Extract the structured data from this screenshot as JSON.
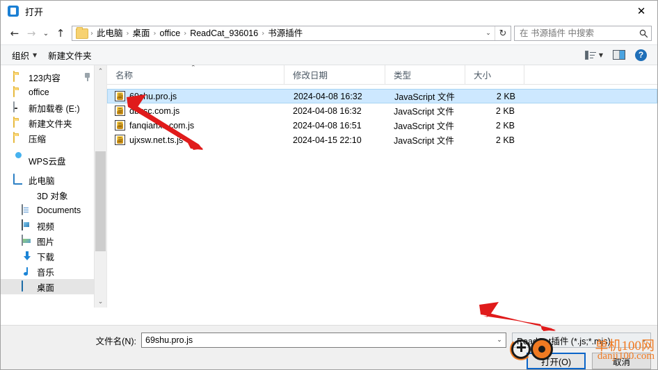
{
  "window": {
    "title": "打开",
    "icon": "open-folder-dialog-icon",
    "close_label": "✕"
  },
  "nav": {
    "back_icon": "←",
    "forward_icon": "→",
    "recent_icon": "⌄",
    "up_icon": "↑",
    "breadcrumbs": [
      "此电脑",
      "桌面",
      "office",
      "ReadCat_936016",
      "书源插件"
    ],
    "separator": "›",
    "address_caret": "⌄",
    "refresh_icon": "↻"
  },
  "search": {
    "placeholder": "在 书源插件 中搜索",
    "value": "",
    "icon": "search-icon"
  },
  "commandbar": {
    "organize_label": "组织",
    "new_folder_label": "新建文件夹",
    "caret": "▼",
    "view_icon": "view-options-icon",
    "view_caret": "▼",
    "preview_icon": "preview-pane-icon",
    "help_icon": "?"
  },
  "sidebar": {
    "items": [
      {
        "label": "123内容",
        "icon": "folder-icon",
        "indent": 0,
        "pinned": true,
        "selected": false
      },
      {
        "label": "office",
        "icon": "folder-icon",
        "indent": 0,
        "pinned": false,
        "selected": false
      },
      {
        "label": "新加载卷 (E:)",
        "icon": "drive-icon",
        "indent": 0,
        "pinned": false,
        "selected": false
      },
      {
        "label": "新建文件夹",
        "icon": "folder-icon",
        "indent": 0,
        "pinned": false,
        "selected": false
      },
      {
        "label": "压缩",
        "icon": "folder-icon",
        "indent": 0,
        "pinned": false,
        "selected": false
      },
      {
        "label": "WPS云盘",
        "icon": "cloud-icon",
        "indent": 0,
        "pinned": false,
        "selected": false
      },
      {
        "label": "此电脑",
        "icon": "computer-icon",
        "indent": 0,
        "pinned": false,
        "selected": false
      },
      {
        "label": "3D 对象",
        "icon": "3d-objects-icon",
        "indent": 1,
        "pinned": false,
        "selected": false
      },
      {
        "label": "Documents",
        "icon": "documents-icon",
        "indent": 1,
        "pinned": false,
        "selected": false
      },
      {
        "label": "视频",
        "icon": "videos-icon",
        "indent": 1,
        "pinned": false,
        "selected": false
      },
      {
        "label": "图片",
        "icon": "pictures-icon",
        "indent": 1,
        "pinned": false,
        "selected": false
      },
      {
        "label": "下载",
        "icon": "downloads-icon",
        "indent": 1,
        "pinned": false,
        "selected": false
      },
      {
        "label": "音乐",
        "icon": "music-icon",
        "indent": 1,
        "pinned": false,
        "selected": false
      },
      {
        "label": "桌面",
        "icon": "desktop-icon",
        "indent": 1,
        "pinned": false,
        "selected": true
      }
    ],
    "scroll_up": "⌃",
    "scroll_down": "⌄"
  },
  "filelist": {
    "columns": [
      {
        "key": "name",
        "label": "名称"
      },
      {
        "key": "date",
        "label": "修改日期"
      },
      {
        "key": "type",
        "label": "类型"
      },
      {
        "key": "size",
        "label": "大小"
      }
    ],
    "sort_caret": "⌃",
    "rows": [
      {
        "name": "69shu.pro.js",
        "date": "2024-04-08 16:32",
        "type": "JavaScript 文件",
        "size": "2 KB",
        "icon": "javascript-file-icon",
        "selected": true
      },
      {
        "name": "dbxsc.com.js",
        "date": "2024-04-08 16:32",
        "type": "JavaScript 文件",
        "size": "2 KB",
        "icon": "javascript-file-icon",
        "selected": false
      },
      {
        "name": "fanqianxs.com.js",
        "date": "2024-04-08 16:51",
        "type": "JavaScript 文件",
        "size": "2 KB",
        "icon": "javascript-file-icon",
        "selected": false
      },
      {
        "name": "ujxsw.net.ts.js",
        "date": "2024-04-15 22:10",
        "type": "JavaScript 文件",
        "size": "2 KB",
        "icon": "javascript-file-icon",
        "selected": false
      }
    ]
  },
  "footer": {
    "filename_label": "文件名(N):",
    "filename_value": "69shu.pro.js",
    "filetype_value": "ReadCat插件 (*.js;*.mjs)",
    "combo_caret": "⌄",
    "open_button": "打开(O)",
    "cancel_button": "取消"
  },
  "watermark": {
    "title": "单机100网",
    "url": "danji100.com",
    "color": "#f07a22"
  },
  "annotations": {
    "arrow_color": "#e01b1b",
    "arrow_file_target": "69shu.pro.js",
    "arrow_type_target": "ReadCat插件 (*.js;*.mjs)"
  }
}
